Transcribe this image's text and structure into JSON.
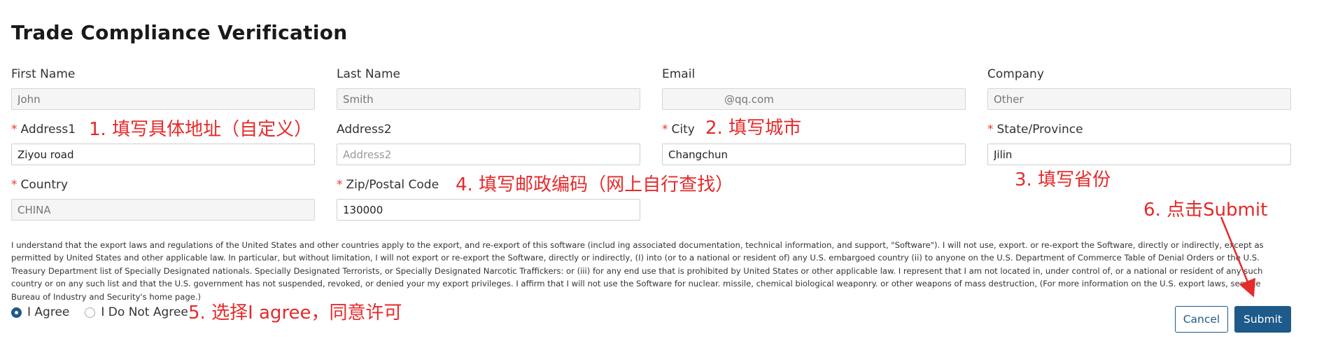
{
  "page": {
    "title": "Trade Compliance Verification"
  },
  "form": {
    "first_name": {
      "label": "First Name",
      "value": "John"
    },
    "last_name": {
      "label": "Last Name",
      "value": "Smith"
    },
    "email": {
      "label": "Email",
      "value": "@qq.com"
    },
    "company": {
      "label": "Company",
      "value": "Other"
    },
    "address1": {
      "label": "Address1",
      "value": "Ziyou road"
    },
    "address2": {
      "label": "Address2",
      "placeholder": "Address2"
    },
    "city": {
      "label": "City",
      "value": "Changchun"
    },
    "state": {
      "label": "State/Province",
      "value": "Jilin"
    },
    "country": {
      "label": "Country",
      "value": "CHINA"
    },
    "zip": {
      "label": "Zip/Postal Code",
      "value": "130000"
    },
    "required_mark": "*"
  },
  "legal_text": "I understand that the export laws and regulations of the United States and other countries apply to the export, and re-export of this software (includ ing associated documentation, technical information, and support, \"Software\"). I will not use, export. or re-export the Software, directly or indirectly, except as permitted by United States and other applicable law. In particular, but without limitation, I will not export or re-export the Software, directly or indirectly, (I) into (or to a national or resident of) any U.S. embargoed country (ii) to anyone on the U.S. Department of Commerce Table of Denial Orders or the U.S. Treasury Department list of Specially Designated nationals. Specially Designated Terrorists, or Specially Designated Narcotic Traffickers: or (iii) for any end use that is prohibited by United States or other applicable law. I represent that I am not located in, under control of, or a national or resident of any such country or on any such list and that the U.S. government has not suspended, revoked, or denied your my export privileges. I affirm that I will not use the Software for nuclear. missile, chemical biological weaponry. or other weapons of mass destruction, (For more information on the U.S. export laws, see the Bureau of Industry and Security's home page.)",
  "agreement": {
    "agree_label": "I Agree",
    "disagree_label": "I Do Not Agree",
    "selected": "I Agree"
  },
  "buttons": {
    "cancel": "Cancel",
    "submit": "Submit"
  },
  "annotations": {
    "a1": "1. 填写具体地址（自定义）",
    "a2": "2. 填写城市",
    "a3": "3. 填写省份",
    "a4": "4. 填写邮政编码（网上自行查找）",
    "a5": "5. 选择I agree，同意许可",
    "a6": "6. 点击Submit"
  },
  "colors": {
    "accent": "#1e5a8a",
    "annotation": "#e52a2a",
    "required": "#e53935"
  }
}
